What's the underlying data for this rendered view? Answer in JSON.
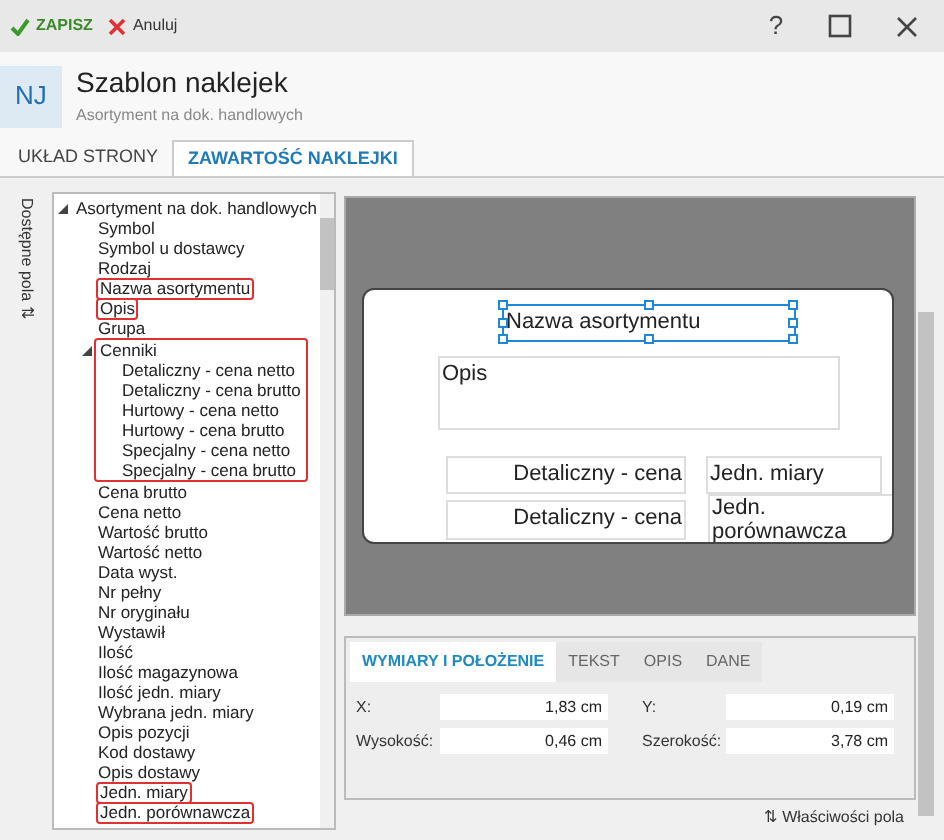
{
  "toolbar": {
    "save": "ZAPISZ",
    "cancel": "Anuluj",
    "help": "?"
  },
  "header": {
    "badge": "NJ",
    "title": "Szablon naklejek",
    "subtitle": "Asortyment na dok. handlowych"
  },
  "tabs": [
    {
      "label": "UKŁAD STRONY",
      "selected": false
    },
    {
      "label": "ZAWARTOŚĆ NAKLEJKI",
      "selected": true
    }
  ],
  "side_label": "Dostępne pola ⇅",
  "tree": [
    {
      "label": "Asortyment na dok. handlowych",
      "expanded": true,
      "highlighted": false,
      "children": [
        {
          "label": "Symbol",
          "highlighted": false
        },
        {
          "label": "Symbol u dostawcy",
          "highlighted": false
        },
        {
          "label": "Rodzaj",
          "highlighted": false
        },
        {
          "label": "Nazwa asortymentu",
          "highlighted": true
        },
        {
          "label": "Opis",
          "highlighted": true
        },
        {
          "label": "Grupa",
          "highlighted": false
        },
        {
          "label": "Cenniki",
          "expanded": true,
          "highlighted": true,
          "children": [
            {
              "label": "Detaliczny - cena netto",
              "highlighted": false
            },
            {
              "label": "Detaliczny - cena brutto",
              "highlighted": false
            },
            {
              "label": "Hurtowy - cena netto",
              "highlighted": false
            },
            {
              "label": "Hurtowy - cena brutto",
              "highlighted": false
            },
            {
              "label": "Specjalny - cena netto",
              "highlighted": false
            },
            {
              "label": "Specjalny - cena brutto",
              "highlighted": false
            }
          ]
        },
        {
          "label": "Cena brutto",
          "highlighted": false
        },
        {
          "label": "Cena netto",
          "highlighted": false
        },
        {
          "label": "Wartość brutto",
          "highlighted": false
        },
        {
          "label": "Wartość netto",
          "highlighted": false
        },
        {
          "label": "Data wyst.",
          "highlighted": false
        },
        {
          "label": "Nr pełny",
          "highlighted": false
        },
        {
          "label": "Nr oryginału",
          "highlighted": false
        },
        {
          "label": "Wystawił",
          "highlighted": false
        },
        {
          "label": "Ilość",
          "highlighted": false
        },
        {
          "label": "Ilość magazynowa",
          "highlighted": false
        },
        {
          "label": "Ilość jedn. miary",
          "highlighted": false
        },
        {
          "label": "Wybrana jedn. miary",
          "highlighted": false
        },
        {
          "label": "Opis pozycji",
          "highlighted": false
        },
        {
          "label": "Kod dostawy",
          "highlighted": false
        },
        {
          "label": "Opis dostawy",
          "highlighted": false
        },
        {
          "label": "Jedn. miary",
          "highlighted": true
        },
        {
          "label": "Jedn. porównawcza",
          "highlighted": true
        }
      ]
    }
  ],
  "label_fields": [
    {
      "text": "Nazwa asortymentu",
      "kind": "center",
      "selected": true
    },
    {
      "text": "Opis",
      "kind": "box",
      "selected": false
    },
    {
      "text": "Detaliczny - cena",
      "kind": "price",
      "selected": false
    },
    {
      "text": "Detaliczny - cena",
      "kind": "price2",
      "selected": false
    },
    {
      "text": "Jedn. miary",
      "kind": "unit",
      "selected": false
    },
    {
      "text": "Jedn. porównawcza",
      "kind": "unit2",
      "selected": false
    }
  ],
  "properties": {
    "tabs": [
      {
        "label": "WYMIARY I POŁOŻENIE",
        "selected": true
      },
      {
        "label": "TEKST",
        "selected": false
      },
      {
        "label": "OPIS",
        "selected": false
      },
      {
        "label": "DANE",
        "selected": false
      }
    ],
    "fields": [
      {
        "label": "X:",
        "value": "1,83 cm"
      },
      {
        "label": "Y:",
        "value": "0,19 cm"
      },
      {
        "label": "Wysokość:",
        "value": "0,46 cm"
      },
      {
        "label": "Szerokość:",
        "value": "3,78 cm"
      }
    ],
    "footer": "⇅ Właściwości pola"
  }
}
